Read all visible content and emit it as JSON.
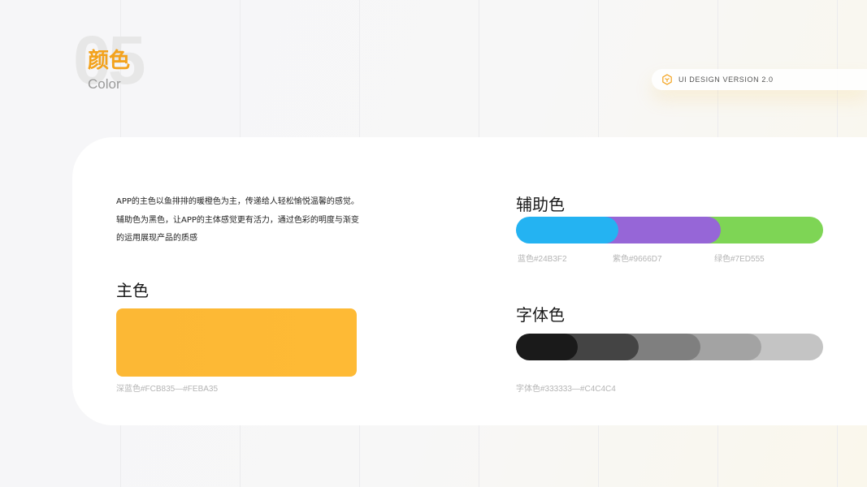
{
  "header": {
    "section_number": "05",
    "title_cn": "颜色",
    "title_en": "Color"
  },
  "version_badge": {
    "text": "UI DESIGN VERSION 2.0",
    "icon": "hexagon-icon"
  },
  "description": {
    "lines": [
      "APP的主色以鱼排排的暖橙色为主，传递给人轻松愉悦温馨的感觉。",
      "辅助色为黑色，让APP的主体感觉更有活力，通过色彩的明度与渐变",
      "的运用展现产品的质感"
    ]
  },
  "primary": {
    "heading": "主色",
    "caption": "深蓝色#FCB835—#FEBA35",
    "colors": [
      "#FCB835",
      "#FEBA35"
    ]
  },
  "auxiliary": {
    "heading": "辅助色",
    "swatches": [
      {
        "label": "蓝色#24B3F2",
        "color": "#24B3F2"
      },
      {
        "label": "紫色#9666D7",
        "color": "#9666D7"
      },
      {
        "label": "绿色#7ED555",
        "color": "#7ED555"
      }
    ]
  },
  "font_colors": {
    "heading": "字体色",
    "caption": "字体色#333333—#C4C4C4",
    "colors": [
      "#1A1A1A",
      "#444444",
      "#7F7F7F",
      "#A3A3A3",
      "#C4C4C4"
    ]
  }
}
